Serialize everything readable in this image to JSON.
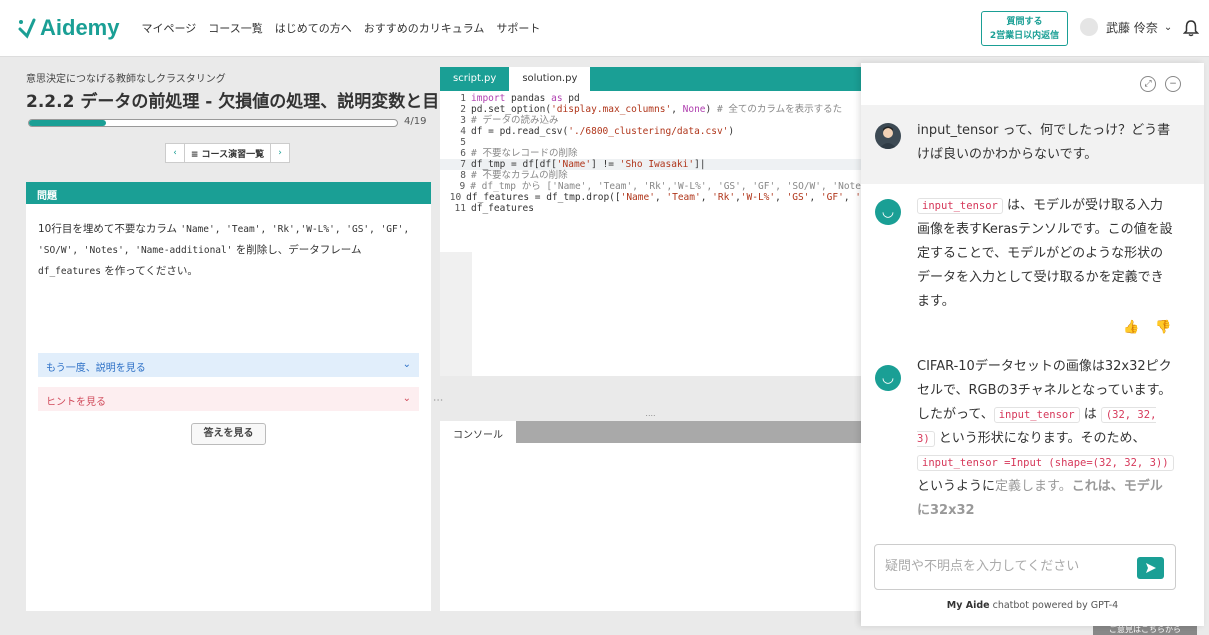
{
  "header": {
    "logo_text": "Aidemy",
    "nav": [
      "マイページ",
      "コース一覧",
      "はじめての方へ",
      "おすすめのカリキュラム",
      "サポート"
    ],
    "support_line1": "質問する",
    "support_line2": "2営業日以内返信",
    "user_name": "武藤 伶奈",
    "colors": {
      "brand": "#1a9f95"
    }
  },
  "lesson": {
    "breadcrumb": "意思決定につなげる教師なしクラスタリング",
    "title": "2.2.2 データの前処理 - 欠損値の処理、説明変数と目...",
    "progress_label": "4/19",
    "progress_fraction": 0.2105,
    "course_list_label": "≡ コース演習一覧",
    "prev_label": "‹",
    "next_label": "›"
  },
  "problem": {
    "heading": "問題",
    "text_part1": "10行目を埋めて不要なカラム ",
    "text_code1": "'Name', 'Team', 'Rk','W-L%', 'GS', 'GF', 'SO/W', 'Notes', 'Name-additional'",
    "text_part2": " を削除し、データフレーム ",
    "text_code2": "df_features",
    "text_part3": " を作ってください。",
    "explain_label": "もう一度、説明を見る",
    "hint_label": "ヒントを見る",
    "answer_label": "答えを見る"
  },
  "editor": {
    "tabs": [
      "script.py",
      "solution.py"
    ],
    "active_tab": "solution.py",
    "console_tab": "コンソール"
  },
  "chat": {
    "user_msg": "input_tensor って、何でしたっけ？どう書けば良いのかわからないです。",
    "bot1_chip": "input_tensor",
    "bot1_text": " は、モデルが受け取る入力画像を表すKerasテンソルです。この値を設定することで、モデルがどのような形状のデータを入力として受け取るかを定義できます。",
    "bot2_a": "CIFAR-10データセットの画像は32x32ピクセルで、RGBの3チャネルとなっています。したがって、",
    "bot2_chip1": "input_tensor",
    "bot2_b": " は ",
    "bot2_chip2": "(32, 32, 3)",
    "bot2_c": " という形状になります。そのため、",
    "bot2_chip3": "input_tensor =Input (shape=(32, 32, 3))",
    "bot2_d": " というように",
    "bot2_fade1": "定義します。",
    "bot2_fade2": "これは、モデルに32x32",
    "input_placeholder": "疑問や不明点を入力してください",
    "footer_bold": "My Aide",
    "footer_rest": " chatbot powered by GPT-4"
  },
  "feedback_label": "ご意見はこちらから"
}
